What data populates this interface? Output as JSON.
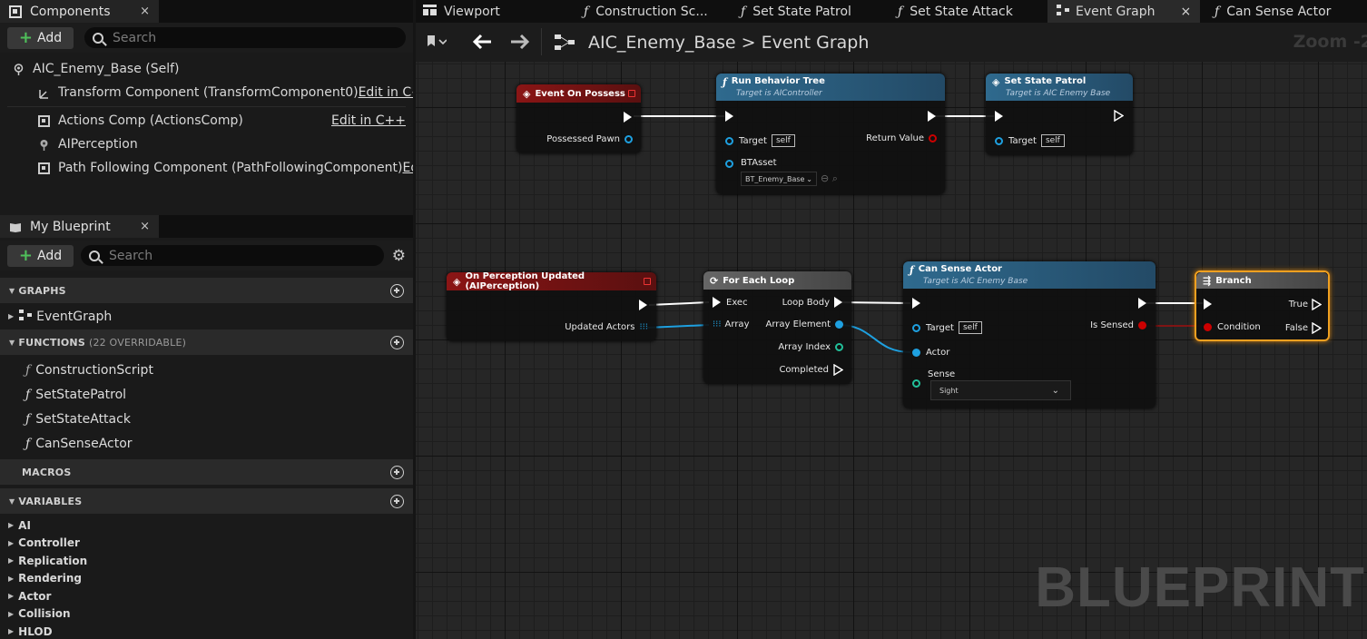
{
  "components_panel": {
    "tab_label": "Components",
    "close": "×",
    "add_label": "Add",
    "search_placeholder": "Search",
    "root": "AIC_Enemy_Base (Self)",
    "items": [
      {
        "label": "Transform Component (TransformComponent0)",
        "action": "Edit in C++"
      },
      {
        "label": "Actions Comp (ActionsComp)",
        "action": "Edit in C++"
      },
      {
        "label": "AIPerception",
        "action": ""
      },
      {
        "label": "Path Following Component (PathFollowingComponent)",
        "action": "Edit"
      }
    ]
  },
  "blueprint_panel": {
    "tab_label": "My Blueprint",
    "close": "×",
    "add_label": "Add",
    "search_placeholder": "Search",
    "graphs_header": "GRAPHS",
    "graphs": [
      "EventGraph"
    ],
    "functions_header": "FUNCTIONS",
    "functions_sub": "(22 OVERRIDABLE)",
    "functions": [
      "ConstructionScript",
      "SetStatePatrol",
      "SetStateAttack",
      "CanSenseActor"
    ],
    "macros_header": "MACROS",
    "variables_header": "VARIABLES",
    "variables": [
      "AI",
      "Controller",
      "Replication",
      "Rendering",
      "Actor",
      "Collision",
      "HLOD"
    ]
  },
  "doc_tabs": {
    "viewport": "Viewport",
    "construction": "Construction Sc...",
    "patrol": "Set State Patrol",
    "attack": "Set State Attack",
    "event_graph": "Event Graph",
    "close": "×",
    "can_sense": "Can Sense Actor"
  },
  "graph_toolbar": {
    "breadcrumb": "AIC_Enemy_Base > Event Graph",
    "zoom": "Zoom -2"
  },
  "watermark": "BLUEPRINT",
  "nodes": {
    "possess": {
      "title": "Event On Possess",
      "pin_pawn": "Possessed Pawn"
    },
    "run_bt": {
      "title": "Run Behavior Tree",
      "subtitle": "Target is AIController",
      "target": "Target",
      "self": "self",
      "return": "Return Value",
      "btasset": "BTAsset",
      "btasset_value": "BT_Enemy_Base"
    },
    "patrol": {
      "title": "Set State Patrol",
      "subtitle": "Target is AIC Enemy Base",
      "target": "Target",
      "self": "self"
    },
    "perception": {
      "title": "On Perception Updated (AIPerception)",
      "pin_actors": "Updated Actors"
    },
    "foreach": {
      "title": "For Each Loop",
      "exec": "Exec",
      "array": "Array",
      "loop_body": "Loop Body",
      "element": "Array Element",
      "index": "Array Index",
      "completed": "Completed"
    },
    "cansense": {
      "title": "Can Sense Actor",
      "subtitle": "Target is AIC Enemy Base",
      "target": "Target",
      "self": "self",
      "actor": "Actor",
      "sense": "Sense",
      "sense_value": "Sight",
      "is_sensed": "Is Sensed"
    },
    "branch": {
      "title": "Branch",
      "condition": "Condition",
      "true": "True",
      "false": "False"
    }
  },
  "colors": {
    "exec": "#ffffff",
    "object": "#1ea0e0",
    "int": "#22c09a",
    "bool": "#c00000",
    "select": "#f0a020"
  }
}
